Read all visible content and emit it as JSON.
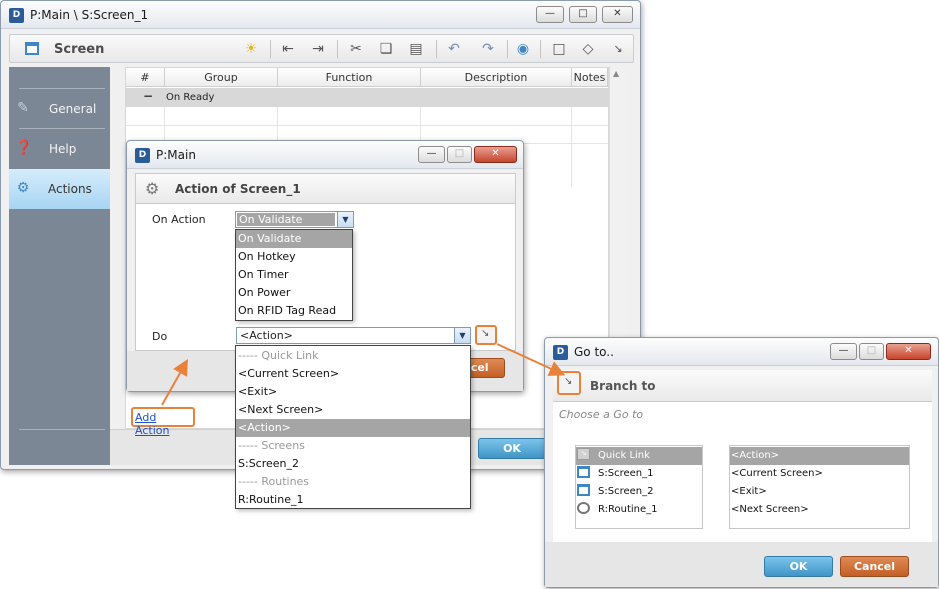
{
  "main_window": {
    "title": "P:Main \\ S:Screen_1",
    "minimize": "—",
    "maximize": "□",
    "close": "✕"
  },
  "toolbar": {
    "screen_label": "Screen",
    "icons": [
      "lightbulb-icon",
      "indent-left-icon",
      "indent-right-icon",
      "cut-icon",
      "copy-icon",
      "paste-icon",
      "undo-icon",
      "redo-icon",
      "info-icon",
      "comment-icon",
      "tag-icon",
      "goto-icon"
    ]
  },
  "sidebar": {
    "items": [
      {
        "label": "General",
        "icon": "general-icon"
      },
      {
        "label": "Help",
        "icon": "help-icon"
      },
      {
        "label": "Actions",
        "icon": "actions-icon",
        "active": true
      }
    ]
  },
  "grid": {
    "columns": [
      "#",
      "Group",
      "Function",
      "Description",
      "Notes"
    ],
    "group_row": {
      "toggle": "−",
      "label": "On Ready"
    }
  },
  "add_action": "Add Action",
  "main_ok": "OK",
  "pmain_dialog": {
    "title": "P:Main",
    "header": "Action of Screen_1",
    "on_action_label": "On Action",
    "on_action_value": "On Validate",
    "on_action_options": [
      "On Validate",
      "On Hotkey",
      "On Timer",
      "On Power",
      "On RFID Tag Read"
    ],
    "do_label": "Do",
    "do_value": "<Action>",
    "do_options": [
      "----- Quick Link",
      "<Current Screen>",
      "<Exit>",
      "<Next Screen>",
      "<Action>",
      "----- Screens",
      "S:Screen_2",
      "----- Routines",
      "R:Routine_1"
    ],
    "cancel_partial": "ncel"
  },
  "goto_dialog": {
    "title": "Go to..",
    "header": "Branch to",
    "subtitle": "Choose a Go to",
    "left_list": [
      {
        "label": "Quick Link",
        "icon": "quick-link-icon"
      },
      {
        "label": "S:Screen_1",
        "icon": "screen-icon"
      },
      {
        "label": "S:Screen_2",
        "icon": "screen-icon"
      },
      {
        "label": "R:Routine_1",
        "icon": "routine-gear-icon"
      }
    ],
    "right_list": [
      "<Action>",
      "<Current Screen>",
      "<Exit>",
      "<Next Screen>"
    ],
    "ok": "OK",
    "cancel": "Cancel"
  },
  "colors": {
    "accent_orange": "#e8823b",
    "ok_blue": "#3f95c8",
    "cancel_orange": "#c25f26",
    "sidebar": "#7b8795"
  }
}
